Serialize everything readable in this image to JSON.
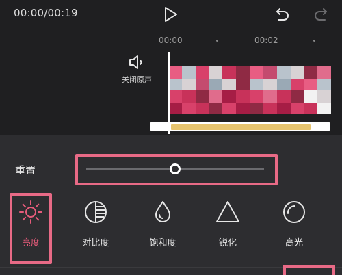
{
  "topbar": {
    "timecode": "00:00/00:19",
    "play_icon": "play-icon",
    "undo_icon": "undo-icon",
    "redo_icon": "redo-icon"
  },
  "timeline": {
    "ruler_labels": [
      "00:00",
      "00:02"
    ],
    "mute_label": "关闭原声",
    "mute_icon": "speaker-icon",
    "playhead_time": "00:00"
  },
  "adjust": {
    "reset_label": "重置",
    "slider_value_fraction": 0.5,
    "tools": [
      {
        "label": "亮度",
        "icon": "brightness-sun-icon",
        "active": true
      },
      {
        "label": "对比度",
        "icon": "contrast-icon",
        "active": false
      },
      {
        "label": "饱和度",
        "icon": "saturation-drop-icon",
        "active": false
      },
      {
        "label": "锐化",
        "icon": "sharpen-triangle-icon",
        "active": false
      },
      {
        "label": "高光",
        "icon": "highlight-circle-icon",
        "active": false
      }
    ]
  },
  "colors": {
    "accent": "#e65b7a",
    "highlight_box": "#e86a86",
    "audio_track": "#e7c46e",
    "background": "#2d2d30",
    "topbar": "#1f1f21"
  }
}
